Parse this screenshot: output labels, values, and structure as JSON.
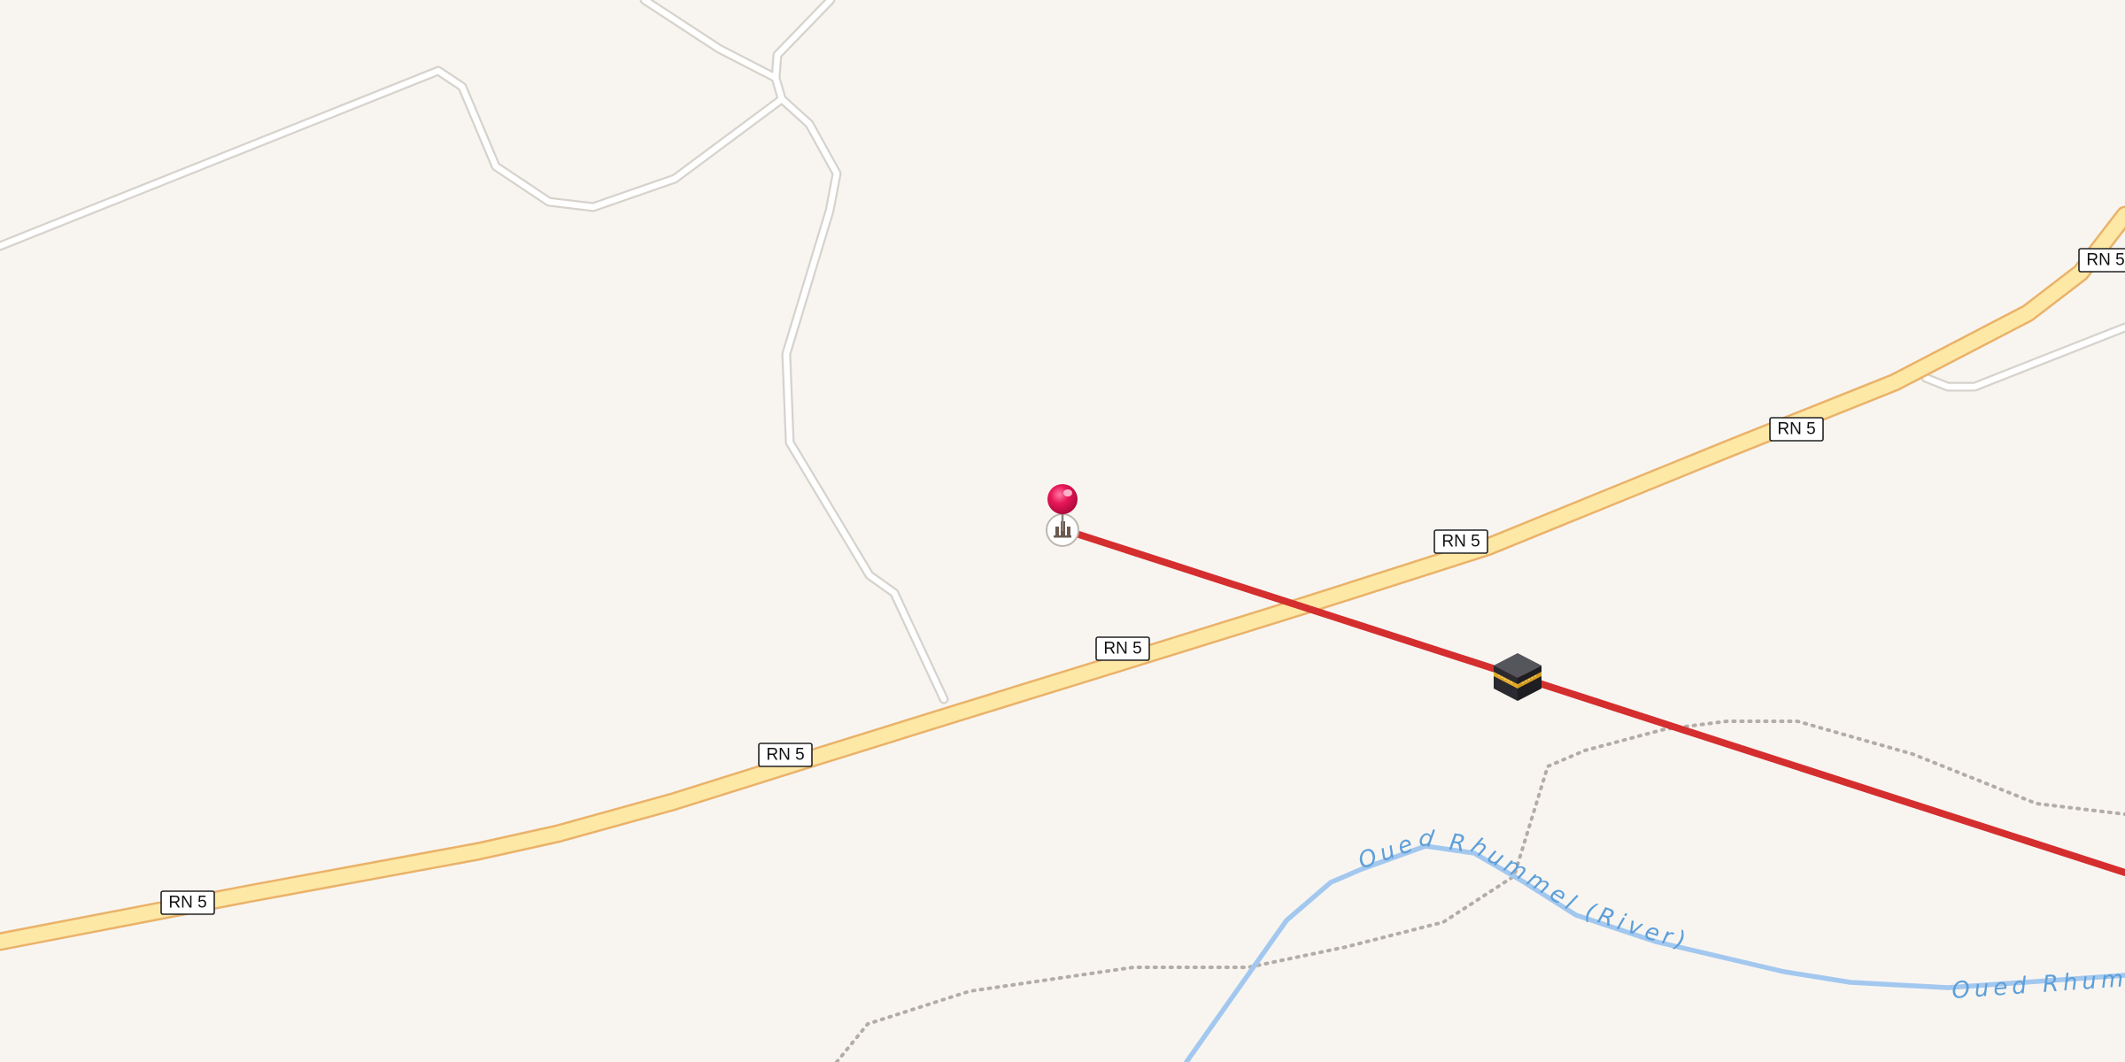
{
  "map": {
    "background_color": "#f8f5f1",
    "road_ref": "RN 5",
    "river_name": "Oued Rhummel (River)",
    "river_name_cut": "Oued Rhumm",
    "colors": {
      "primary_road_fill": "#fde8a6",
      "primary_road_casing": "#eab269",
      "minor_road_fill": "#ffffff",
      "minor_road_casing": "#d6d2cc",
      "river": "#a3c8ef",
      "river_label": "#5d9fd8",
      "boundary": "#b3aca7",
      "qibla_line": "#d42e2e",
      "marker_pin": "#e8185a"
    },
    "icons": {
      "location_marker": "pin-marker-icon",
      "mosque_poi": "mosque-icon",
      "qibla_target": "kaaba-icon"
    }
  }
}
